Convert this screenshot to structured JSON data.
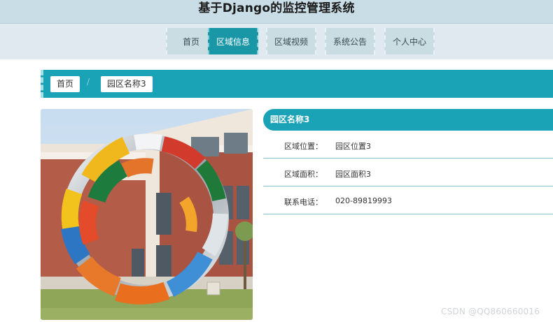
{
  "site": {
    "title": "基于Django的监控管理系统"
  },
  "nav": {
    "items": [
      {
        "label": "首页"
      },
      {
        "label": "区域信息"
      },
      {
        "label": "区域视频"
      },
      {
        "label": "系统公告"
      },
      {
        "label": "个人中心"
      }
    ],
    "active_index": 1
  },
  "breadcrumb": {
    "home": "首页",
    "separator": "/",
    "current": "园区名称3"
  },
  "detail": {
    "name": "园区名称3",
    "fields": [
      {
        "label": "区域位置：",
        "value": "园区位置3"
      },
      {
        "label": "区域面积：",
        "value": "园区面积3"
      },
      {
        "label": "联系电话：",
        "value": "020-89819993"
      }
    ]
  },
  "watermark": "CSDN @QQ860660016",
  "colors": {
    "accent": "#1aa2b6",
    "nav_bg": "#dfe9ef",
    "header_bg": "#c9dde6"
  }
}
